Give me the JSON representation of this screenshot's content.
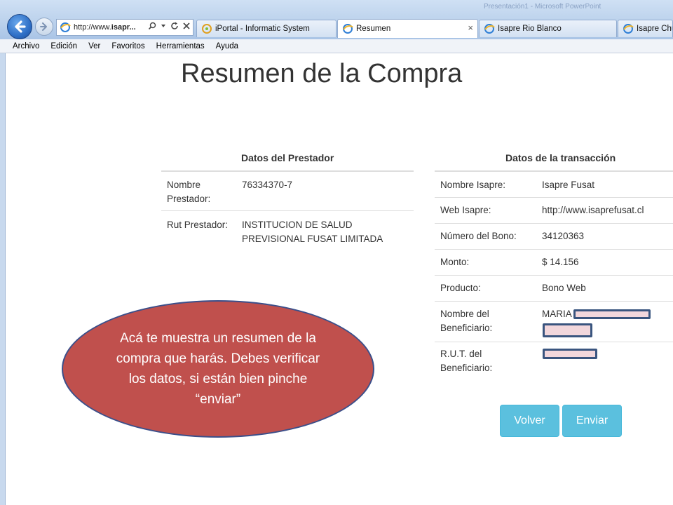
{
  "browser": {
    "window_title": "Presentación1 - Microsoft PowerPoint",
    "address_prefix": "http://www.",
    "address_bold": "isapr...",
    "tabs": [
      {
        "label": "iPortal - Informatic System"
      },
      {
        "label": "Resumen"
      },
      {
        "label": "Isapre Rio Blanco"
      },
      {
        "label": "Isapre Chu"
      }
    ],
    "tab_close": "×",
    "menu": [
      "Archivo",
      "Edición",
      "Ver",
      "Favoritos",
      "Herramientas",
      "Ayuda"
    ]
  },
  "page": {
    "title": "Resumen de la Compra"
  },
  "prestador": {
    "heading": "Datos del Prestador",
    "rows": [
      {
        "label": "Nombre Prestador:",
        "value": "76334370-7"
      },
      {
        "label": "Rut Prestador:",
        "value": "INSTITUCION DE SALUD PREVISIONAL FUSAT LIMITADA"
      }
    ]
  },
  "transaccion": {
    "heading": "Datos de la transacción",
    "rows": [
      {
        "label": "Nombre Isapre:",
        "value": "Isapre Fusat"
      },
      {
        "label": "Web Isapre:",
        "value": "http://www.isaprefusat.cl"
      },
      {
        "label": "Número del Bono:",
        "value": "34120363"
      },
      {
        "label": "Monto:",
        "value": "$ 14.156"
      },
      {
        "label": "Producto:",
        "value": "Bono Web"
      },
      {
        "label": "Nombre del Beneficiario:",
        "value": "MARIA"
      },
      {
        "label": "R.U.T. del Beneficiario:",
        "value": ""
      }
    ]
  },
  "callout": {
    "text": "Acá te muestra un resumen de la compra que harás. Debes verificar los datos, si están bien  pinche “enviar”"
  },
  "buttons": {
    "volver": "Volver",
    "enviar": "Enviar"
  },
  "colors": {
    "button": "#5bc0de",
    "callout_fill": "#c0504d",
    "callout_border": "#3b4f8a",
    "redaction_border": "#3a557f"
  }
}
